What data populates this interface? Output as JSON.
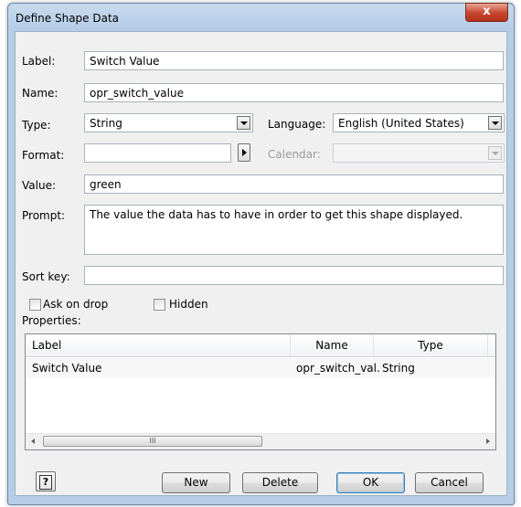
{
  "window": {
    "title": "Define Shape Data",
    "close_glyph": "x"
  },
  "form": {
    "label_caption": "Label:",
    "label_value": "Switch Value",
    "name_caption": "Name:",
    "name_value": "opr_switch_value",
    "type_caption": "Type:",
    "type_value": "String",
    "language_caption": "Language:",
    "language_value": "English (United States)",
    "format_caption": "Format:",
    "format_value": "",
    "calendar_caption": "Calendar:",
    "calendar_value": "",
    "value_caption": "Value:",
    "value_value": "green",
    "prompt_caption": "Prompt:",
    "prompt_value": "The value the data has to have in order to get this shape displayed.",
    "sortkey_caption": "Sort key:",
    "sortkey_value": "",
    "ask_on_drop_label": "Ask on drop",
    "ask_on_drop_checked": false,
    "hidden_label": "Hidden",
    "hidden_checked": false
  },
  "properties": {
    "caption": "Properties:",
    "columns": [
      "Label",
      "Name",
      "Type"
    ],
    "rows": [
      {
        "label": "Switch Value",
        "name": "opr_switch_val...",
        "type": "String"
      }
    ],
    "scroll_thumb_glyph": "III"
  },
  "buttons": {
    "help": "?",
    "new": "New",
    "delete": "Delete",
    "ok": "OK",
    "cancel": "Cancel"
  },
  "icons": {
    "close": "close-icon",
    "dropdown": "chevron-down-icon",
    "help": "help-icon"
  }
}
